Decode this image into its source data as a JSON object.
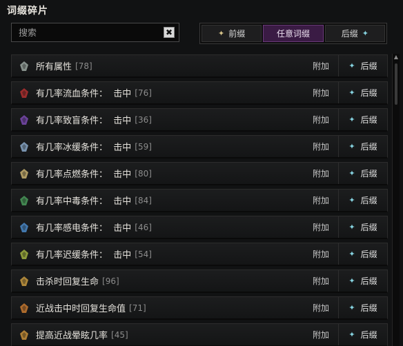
{
  "panel": {
    "title": "词缀碎片"
  },
  "search": {
    "placeholder": "搜索",
    "clear_label": "✖"
  },
  "filters": [
    {
      "label": "前缀",
      "icon": "star-gold-icon",
      "active": false
    },
    {
      "label": "任意词缀",
      "icon": "",
      "active": true
    },
    {
      "label": "后缀",
      "icon": "star-teal-icon",
      "active": false
    }
  ],
  "row_actions": {
    "attach": "附加",
    "suffix": "后缀"
  },
  "affixes": [
    {
      "name": "所有属性",
      "count": "[78]",
      "icon_color": "#9aa6a0"
    },
    {
      "name": "有几率流血条件：  击中",
      "count": "[76]",
      "icon_color": "#b03030"
    },
    {
      "name": "有几率致盲条件：  击中",
      "count": "[36]",
      "icon_color": "#7a4ab0"
    },
    {
      "name": "有几率冰缓条件：  击中",
      "count": "[59]",
      "icon_color": "#8aa8c8"
    },
    {
      "name": "有几率点燃条件：  击中",
      "count": "[80]",
      "icon_color": "#c8b070"
    },
    {
      "name": "有几率中毒条件：  击中",
      "count": "[84]",
      "icon_color": "#4a9a5a"
    },
    {
      "name": "有几率感电条件：  击中",
      "count": "[46]",
      "icon_color": "#4a8ac8"
    },
    {
      "name": "有几率迟缓条件：  击中",
      "count": "[54]",
      "icon_color": "#a0b040"
    },
    {
      "name": "击杀时回复生命",
      "count": "[96]",
      "icon_color": "#c89a40"
    },
    {
      "name": "近战击中时回复生命值",
      "count": "[71]",
      "icon_color": "#c87a30"
    },
    {
      "name": "提高近战晕眩几率",
      "count": "[45]",
      "icon_color": "#c8903a"
    }
  ]
}
